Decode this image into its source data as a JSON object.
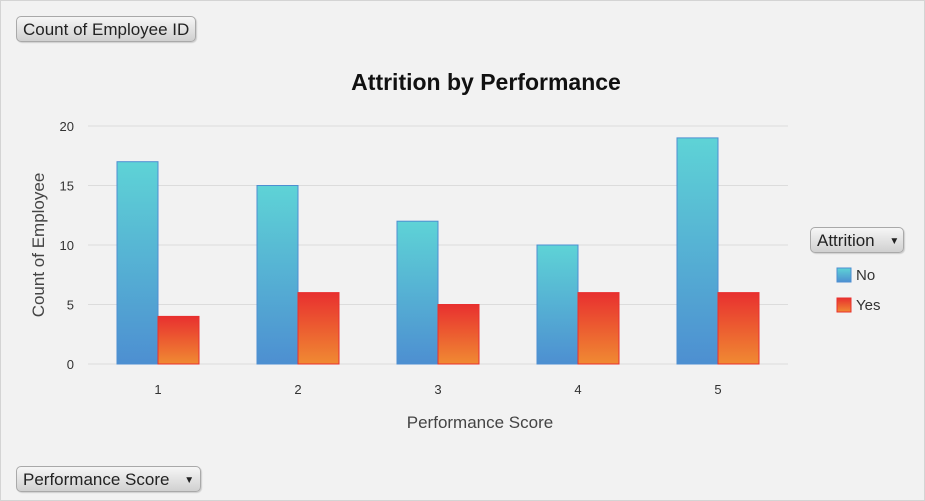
{
  "field_buttons": {
    "value_field": "Count of Employee ID",
    "axis_field": "Performance Score",
    "legend_field": "Attrition"
  },
  "colors": {
    "no_top": "#5ed3d6",
    "no_bottom": "#4d8fd1",
    "yes_top": "#e8302f",
    "yes_bottom": "#f08a32",
    "gridline": "#dcdcdc"
  },
  "chart_data": {
    "type": "bar",
    "title": "Attrition by Performance",
    "xlabel": "Performance Score",
    "ylabel": "Count of Employee",
    "categories": [
      "1",
      "2",
      "3",
      "4",
      "5"
    ],
    "series": [
      {
        "name": "No",
        "values": [
          17,
          15,
          12,
          10,
          19
        ]
      },
      {
        "name": "Yes",
        "values": [
          4,
          6,
          5,
          6,
          6
        ]
      }
    ],
    "ylim": [
      0,
      20
    ],
    "yticks": [
      0,
      5,
      10,
      15,
      20
    ],
    "grid": true,
    "legend_position": "right"
  }
}
